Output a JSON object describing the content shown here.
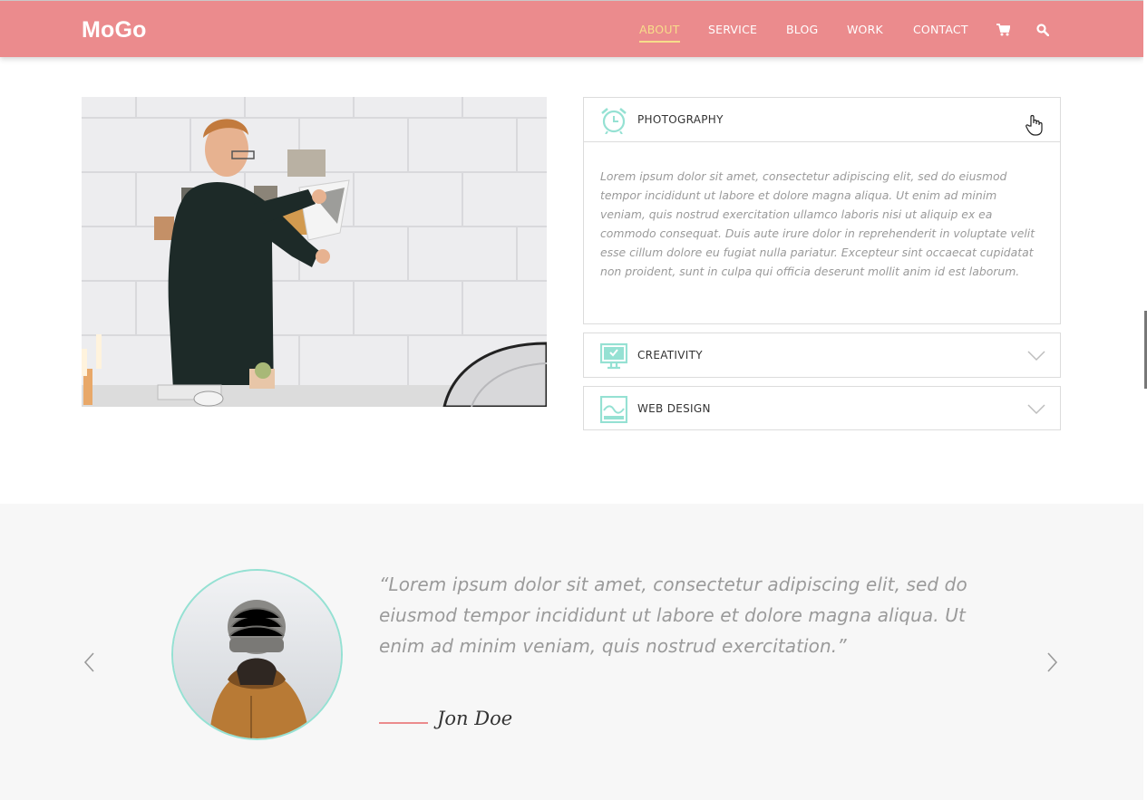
{
  "header": {
    "logo": "MoGo",
    "nav": [
      {
        "label": "ABOUT",
        "active": true
      },
      {
        "label": "SERVICE",
        "active": false
      },
      {
        "label": "BLOG",
        "active": false
      },
      {
        "label": "WORK",
        "active": false
      },
      {
        "label": "CONTACT",
        "active": false
      }
    ],
    "cart_icon": "cart-icon",
    "search_icon": "search-icon"
  },
  "accordion": [
    {
      "title": "PHOTOGRAPHY",
      "icon": "alarm-clock-icon",
      "expanded": true,
      "body": "Lorem ipsum dolor sit amet, consectetur adipiscing elit, sed do eiusmod tempor incididunt ut labore et dolore magna aliqua. Ut enim ad minim veniam, quis nostrud exercitation ullamco laboris nisi ut aliquip ex ea commodo consequat. Duis aute irure dolor in reprehenderit in voluptate velit esse cillum dolore eu fugiat nulla pariatur. Excepteur sint occaecat cupidatat non proident, sunt in culpa qui officia deserunt mollit anim id est laborum."
    },
    {
      "title": "CREATIVITY",
      "icon": "monitor-icon",
      "expanded": false
    },
    {
      "title": "WEB DESIGN",
      "icon": "chart-wave-icon",
      "expanded": false
    }
  ],
  "testimonial": {
    "quote": "“Lorem ipsum dolor sit amet, consectetur adipiscing elit, sed do eiusmod tempor incididunt ut labore et dolore magna aliqua. Ut enim ad minim veniam, quis nostrud exercitation.”",
    "author": "Jon Doe"
  },
  "colors": {
    "brand": "#eb8b8d",
    "accent_mint": "#95e1d3",
    "nav_active": "#f7dd8a",
    "band_bg": "#f7f7f7"
  }
}
